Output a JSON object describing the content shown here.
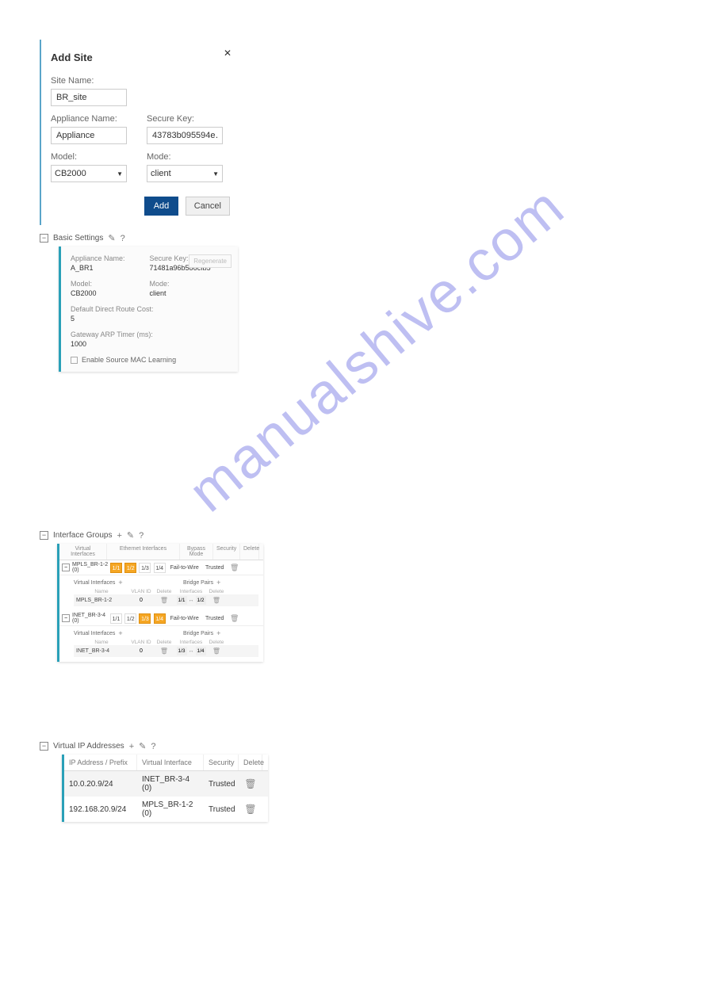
{
  "watermark": "manualshive.com",
  "addSite": {
    "title": "Add Site",
    "siteName": {
      "label": "Site Name:",
      "value": "BR_site"
    },
    "applianceName": {
      "label": "Appliance Name:",
      "value": "Appliance"
    },
    "secureKey": {
      "label": "Secure Key:",
      "value": "43783b095594e…"
    },
    "model": {
      "label": "Model:",
      "value": "CB2000"
    },
    "mode": {
      "label": "Mode:",
      "value": "client"
    },
    "addBtn": "Add",
    "cancelBtn": "Cancel"
  },
  "basicSettings": {
    "header": "Basic Settings",
    "applianceName": {
      "label": "Appliance Name:",
      "value": "A_BR1"
    },
    "secureKey": {
      "label": "Secure Key:",
      "value": "71481a96b586cfb5"
    },
    "regenerate": "Regenerate",
    "model": {
      "label": "Model:",
      "value": "CB2000"
    },
    "mode": {
      "label": "Mode:",
      "value": "client"
    },
    "defaultCost": {
      "label": "Default Direct Route Cost:",
      "value": "5"
    },
    "arpTimer": {
      "label": "Gateway ARP Timer (ms):",
      "value": "1000"
    },
    "enableMac": "Enable Source MAC Learning"
  },
  "interfaceGroups": {
    "header": "Interface Groups",
    "cols": {
      "vi": "Virtual Interfaces",
      "ei": "Ethernet Interfaces",
      "bm": "Bypass Mode",
      "sec": "Security",
      "del": "Delete"
    },
    "groups": [
      {
        "name": "MPLS_BR-1-2 (0)",
        "ports": [
          {
            "label": "1/1",
            "on": true
          },
          {
            "label": "1/2",
            "on": true
          },
          {
            "label": "1/3",
            "on": false
          },
          {
            "label": "1/4",
            "on": false
          }
        ],
        "bypass": "Fail-to-Wire",
        "security": "Trusted",
        "vi": {
          "name": "MPLS_BR-1-2",
          "vlan": "0"
        },
        "bp": {
          "a": "1/1",
          "b": "1/2"
        }
      },
      {
        "name": "INET_BR-3-4 (0)",
        "ports": [
          {
            "label": "1/1",
            "on": false
          },
          {
            "label": "1/2",
            "on": false
          },
          {
            "label": "1/3",
            "on": true
          },
          {
            "label": "1/4",
            "on": true
          }
        ],
        "bypass": "Fail-to-Wire",
        "security": "Trusted",
        "vi": {
          "name": "INET_BR-3-4",
          "vlan": "0"
        },
        "bp": {
          "a": "1/3",
          "b": "1/4"
        }
      }
    ],
    "sub": {
      "viTitle": "Virtual Interfaces",
      "bpTitle": "Bridge Pairs",
      "name": "Name",
      "vlan": "VLAN ID",
      "del": "Delete",
      "if": "Interfaces"
    }
  },
  "virtualIp": {
    "header": "Virtual IP Addresses",
    "cols": {
      "ip": "IP Address / Prefix",
      "vi": "Virtual Interface",
      "sec": "Security",
      "del": "Delete"
    },
    "rows": [
      {
        "ip": "10.0.20.9/24",
        "vi": "INET_BR-3-4 (0)",
        "sec": "Trusted"
      },
      {
        "ip": "192.168.20.9/24",
        "vi": "MPLS_BR-1-2 (0)",
        "sec": "Trusted"
      }
    ]
  }
}
